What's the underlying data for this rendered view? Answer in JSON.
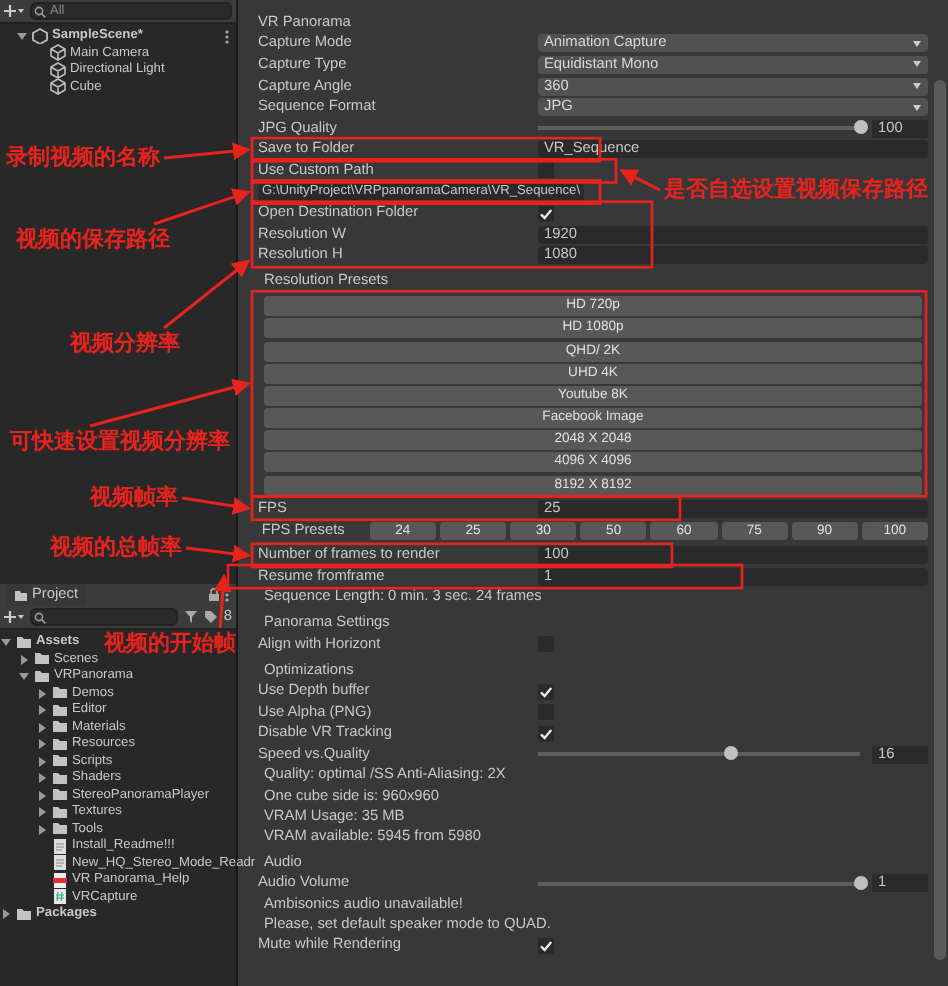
{
  "hierarchy": {
    "search": {
      "placeholder": "All"
    },
    "items": [
      {
        "label": "SampleScene*",
        "kind": "scene",
        "expanded": true,
        "children": [
          {
            "label": "Main Camera",
            "kind": "object"
          },
          {
            "label": "Directional Light",
            "kind": "object"
          },
          {
            "label": "Cube",
            "kind": "object"
          }
        ]
      }
    ]
  },
  "project": {
    "tab": "Project",
    "badge": "8",
    "items": [
      {
        "label": "Assets",
        "kind": "folder",
        "expanded": true,
        "children": [
          {
            "label": "Scenes",
            "kind": "folder",
            "expanded": false
          },
          {
            "label": "VRPanorama",
            "kind": "folder",
            "expanded": true,
            "children": [
              {
                "label": "Demos",
                "kind": "folder",
                "expanded": false
              },
              {
                "label": "Editor",
                "kind": "folder",
                "expanded": false
              },
              {
                "label": "Materials",
                "kind": "folder",
                "expanded": false
              },
              {
                "label": "Resources",
                "kind": "folder",
                "expanded": false
              },
              {
                "label": "Scripts",
                "kind": "folder",
                "expanded": false
              },
              {
                "label": "Shaders",
                "kind": "folder",
                "expanded": false
              },
              {
                "label": "StereoPanoramaPlayer",
                "kind": "folder",
                "expanded": false
              },
              {
                "label": "Textures",
                "kind": "folder",
                "expanded": false
              },
              {
                "label": "Tools",
                "kind": "folder",
                "expanded": false
              },
              {
                "label": "Install_Readme!!!",
                "kind": "doc"
              },
              {
                "label": "New_HQ_Stereo_Mode_Readr",
                "kind": "doc"
              },
              {
                "label": "VR Panorama_Help",
                "kind": "pdf"
              },
              {
                "label": "VRCapture",
                "kind": "script"
              }
            ]
          }
        ]
      },
      {
        "label": "Packages",
        "kind": "folder",
        "expanded": false
      }
    ]
  },
  "inspector": {
    "rows": [
      {
        "kind": "header",
        "label": "VR Panorama"
      },
      {
        "kind": "dropdown",
        "label": "Capture Mode",
        "value": "Animation Capture"
      },
      {
        "kind": "dropdown",
        "label": "Capture Type",
        "value": "Equidistant Mono"
      },
      {
        "kind": "dropdown",
        "label": "Capture Angle",
        "value": "360"
      },
      {
        "kind": "dropdown",
        "label": "Sequence Format",
        "value": "JPG"
      },
      {
        "kind": "slider",
        "label": "JPG Quality",
        "level": 1.0,
        "reading": "100"
      },
      {
        "kind": "field",
        "label": "Save to Folder",
        "value": "VR_Sequence"
      },
      {
        "kind": "checkbox",
        "label": "Use Custom Path",
        "checked": false
      },
      {
        "kind": "path",
        "value": "G:\\UnityProject\\VRPpanoramaCamera\\VR_Sequence\\"
      },
      {
        "kind": "checkbox",
        "label": "Open Destination Folder",
        "checked": true
      },
      {
        "kind": "field",
        "label": "Resolution W",
        "value": "1920"
      },
      {
        "kind": "field",
        "label": "Resolution H",
        "value": "1080"
      },
      {
        "kind": "section",
        "label": "Resolution Presets"
      },
      {
        "kind": "presets",
        "buttons": [
          "HD 720p",
          "HD 1080p",
          "QHD/ 2K",
          "UHD 4K",
          "Youtube 8K",
          "Facebook Image",
          "2048 X 2048",
          "4096 X 4096",
          "8192 X 8192"
        ]
      },
      {
        "kind": "field",
        "label": "FPS",
        "value": "25"
      },
      {
        "kind": "fps_presets",
        "label": "FPS Presets",
        "buttons": [
          "24",
          "25",
          "30",
          "50",
          "60",
          "75",
          "90",
          "100"
        ]
      },
      {
        "kind": "field",
        "label": "Number of frames to render",
        "value": "100"
      },
      {
        "kind": "field",
        "label": "Resume fromframe",
        "value": "1"
      },
      {
        "kind": "note",
        "text": "Sequence Length: 0 min. 3 sec. 24 frames"
      },
      {
        "kind": "section",
        "label": "Panorama Settings"
      },
      {
        "kind": "checkbox",
        "label": "Align with Horizont",
        "checked": false
      },
      {
        "kind": "section",
        "label": "Optimizations"
      },
      {
        "kind": "checkbox",
        "label": "Use Depth buffer",
        "checked": true
      },
      {
        "kind": "checkbox",
        "label": "Use Alpha (PNG)",
        "checked": false
      },
      {
        "kind": "checkbox",
        "label": "Disable VR Tracking",
        "checked": true
      },
      {
        "kind": "slider",
        "label": "Speed vs.Quality",
        "level": 0.6,
        "reading": "16"
      },
      {
        "kind": "note",
        "text": "Quality: optimal  /SS Anti-Aliasing: 2X"
      },
      {
        "kind": "note",
        "text": "One cube side is: 960x960"
      },
      {
        "kind": "note",
        "text": "VRAM Usage: 35 MB"
      },
      {
        "kind": "note",
        "text": "VRAM available: 5945 from 5980"
      },
      {
        "kind": "section",
        "label": "Audio"
      },
      {
        "kind": "slider",
        "label": "Audio Volume",
        "level": 1.0,
        "reading": "1"
      },
      {
        "kind": "note",
        "text": "Ambisonics audio unavailable!"
      },
      {
        "kind": "note",
        "text": "Please, set default speaker mode to QUAD."
      },
      {
        "kind": "checkbox",
        "label": "Mute while Rendering",
        "checked": true
      }
    ]
  },
  "annotations": [
    {
      "text": "录制视频的名称"
    },
    {
      "text": "是否自选设置视频保存路径"
    },
    {
      "text": "视频的保存路径"
    },
    {
      "text": "视频分辨率"
    },
    {
      "text": "可快速设置视频分辨率"
    },
    {
      "text": "视频帧率"
    },
    {
      "text": "视频的总帧率"
    },
    {
      "text": "视频的开始帧"
    }
  ]
}
